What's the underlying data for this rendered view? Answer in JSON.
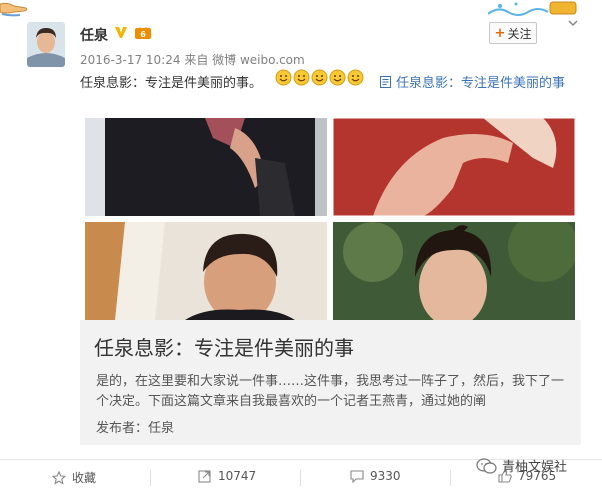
{
  "post": {
    "username": "任泉",
    "timestamp": "2016-3-17 10:24",
    "source_prefix": "来自",
    "source": "微博 weibo.com",
    "follow_label": "关注",
    "text": "任泉息影：专注是件美丽的事。",
    "article_link": "任泉息影：专注是件美丽的事"
  },
  "card": {
    "title": "任泉息影：专注是件美丽的事",
    "body": "是的，在这里要和大家说一件事……这件事，我思考过一阵子了，然后，我下了一个决定。下面这篇文章来自我最喜欢的一个记者王燕青，通过她的阐",
    "author": "发布者：任泉"
  },
  "actions": {
    "favorite_label": "收藏",
    "repost_count": "10747",
    "comment_count": "9330",
    "like_count": "79765"
  },
  "watermark": {
    "text": "青柚文娱社"
  },
  "icons": {
    "verified": "verified-v-icon",
    "vip": "vip-crown-icon",
    "close": "chevron-down-icon",
    "article": "article-doc-icon",
    "favorite": "star-icon",
    "repost": "repost-icon",
    "comment": "comment-icon",
    "like": "thumbs-up-icon"
  },
  "colors": {
    "link": "#3b73b9",
    "accent_orange": "#e36c00",
    "card_bg": "#f2f2f2"
  }
}
